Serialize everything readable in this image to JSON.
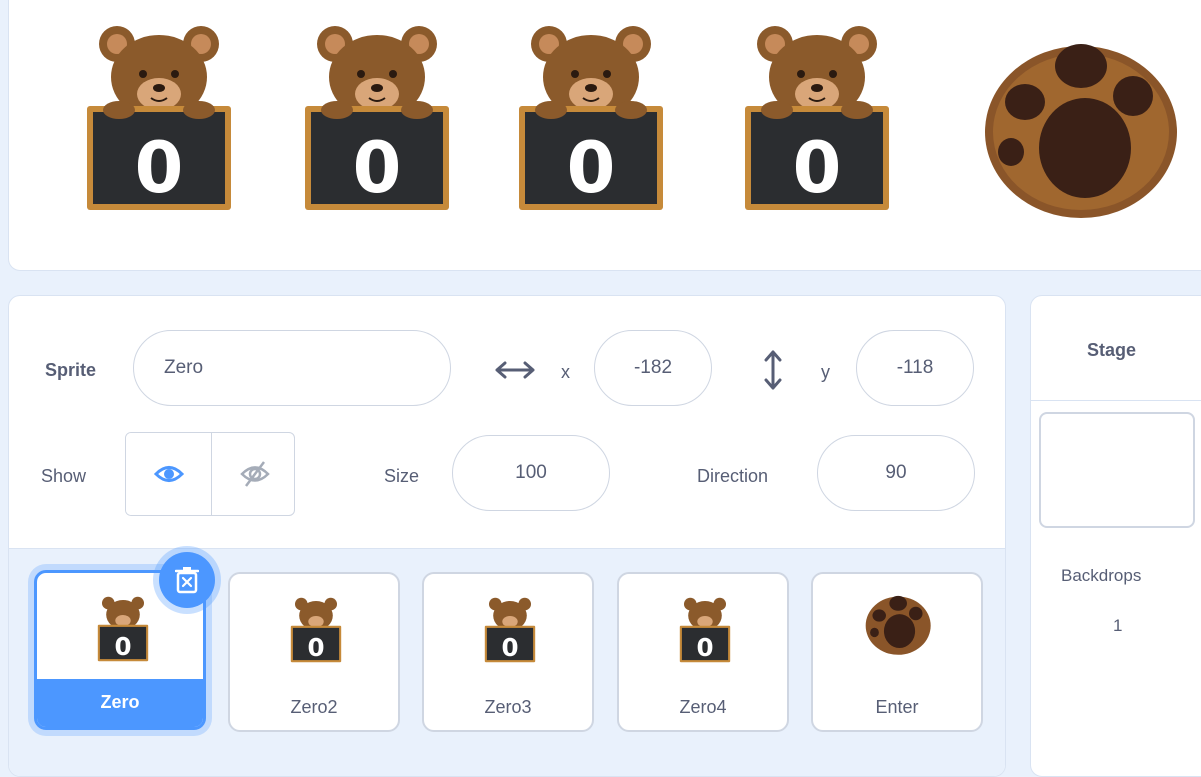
{
  "stage": {
    "bears": [
      {
        "digit": "0"
      },
      {
        "digit": "0"
      },
      {
        "digit": "0"
      },
      {
        "digit": "0"
      }
    ]
  },
  "sprite_info": {
    "sprite_label": "Sprite",
    "sprite_name": "Zero",
    "x_label": "x",
    "x_value": "-182",
    "y_label": "y",
    "y_value": "-118",
    "show_label": "Show",
    "size_label": "Size",
    "size_value": "100",
    "direction_label": "Direction",
    "direction_value": "90"
  },
  "sprites": [
    {
      "name": "Zero",
      "digit": "0",
      "selected": true
    },
    {
      "name": "Zero2",
      "digit": "0"
    },
    {
      "name": "Zero3",
      "digit": "0"
    },
    {
      "name": "Zero4",
      "digit": "0"
    },
    {
      "name": "Enter"
    }
  ],
  "stage_panel": {
    "title": "Stage",
    "backdrops_label": "Backdrops",
    "backdrops_count": "1"
  },
  "colors": {
    "accent": "#4c97ff",
    "text": "#575e75",
    "border": "#cfd6e2",
    "bear_brown": "#8b5a2b",
    "board": "#2b2d30",
    "paw_outer": "#8a5529"
  },
  "icons": [
    "bear-sprite-icon",
    "paw-sprite-icon",
    "x-arrows-icon",
    "y-arrows-icon",
    "eye-icon",
    "eye-slash-icon",
    "trash-icon"
  ]
}
